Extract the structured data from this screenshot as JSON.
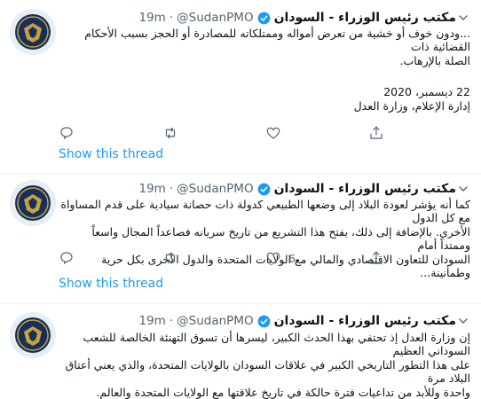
{
  "colors": {
    "link": "#1d9bf0",
    "muted": "#536471",
    "verified": "#1d9bf0"
  },
  "tweets": [
    {
      "name": "مكتب رئيس الوزراء - السودان",
      "handle": "@SudanPMO",
      "time": "19m",
      "dot": "·",
      "lines": [
        "...ودون خوف أو خشية من تعرض أمواله وممتلكاته للمصادرة أو الحجز بسبب الأحكام القضائية ذات",
        "الصلة بالإرهاب.",
        "",
        "22 ديسمبر، 2020",
        "إدارة الإعلام، وزارة العدل"
      ],
      "reply_count": "",
      "retweet_count": "",
      "like_count": "",
      "show_thread": "Show this thread"
    },
    {
      "name": "مكتب رئيس الوزراء - السودان",
      "handle": "@SudanPMO",
      "time": "19m",
      "dot": "·",
      "lines": [
        "كما أنه يؤشر لعودة البلاد إلى وضعها الطبيعي كدولة ذات حصانة سيادية على قدم المساواة مع كل الدول",
        "الأخرى. بالإضافة إلى ذلك، يفتح هذا التشريع من تاريخ سريانه فصاعداً المجال واسعاً وممتداً أمام",
        "السودان للتعاون الاقتصادي والمالي مع الولايات المتحدة والدول الأخرى بكل حرية وطمأنينة..."
      ],
      "reply_count": "",
      "retweet_count": "",
      "like_count": "6",
      "show_thread": "Show this thread"
    },
    {
      "name": "مكتب رئيس الوزراء - السودان",
      "handle": "@SudanPMO",
      "time": "19m",
      "dot": "·",
      "lines": [
        "إن وزارة العدل إذ تحتفي بهذا الحدث الكبير، ليسرها أن تسوق التهنئة الخالصة للشعب السوداني العظيم",
        "على هذا التطور التاريخي الكبير في علاقات السودان بالولايات المتحدة، والذي يعني أعتاق البلاد مرة",
        "واحدة وللأبد من تداعيات فترة حالكة في تاريخ علاقتها مع الولايات المتحدة والعالم."
      ]
    }
  ]
}
